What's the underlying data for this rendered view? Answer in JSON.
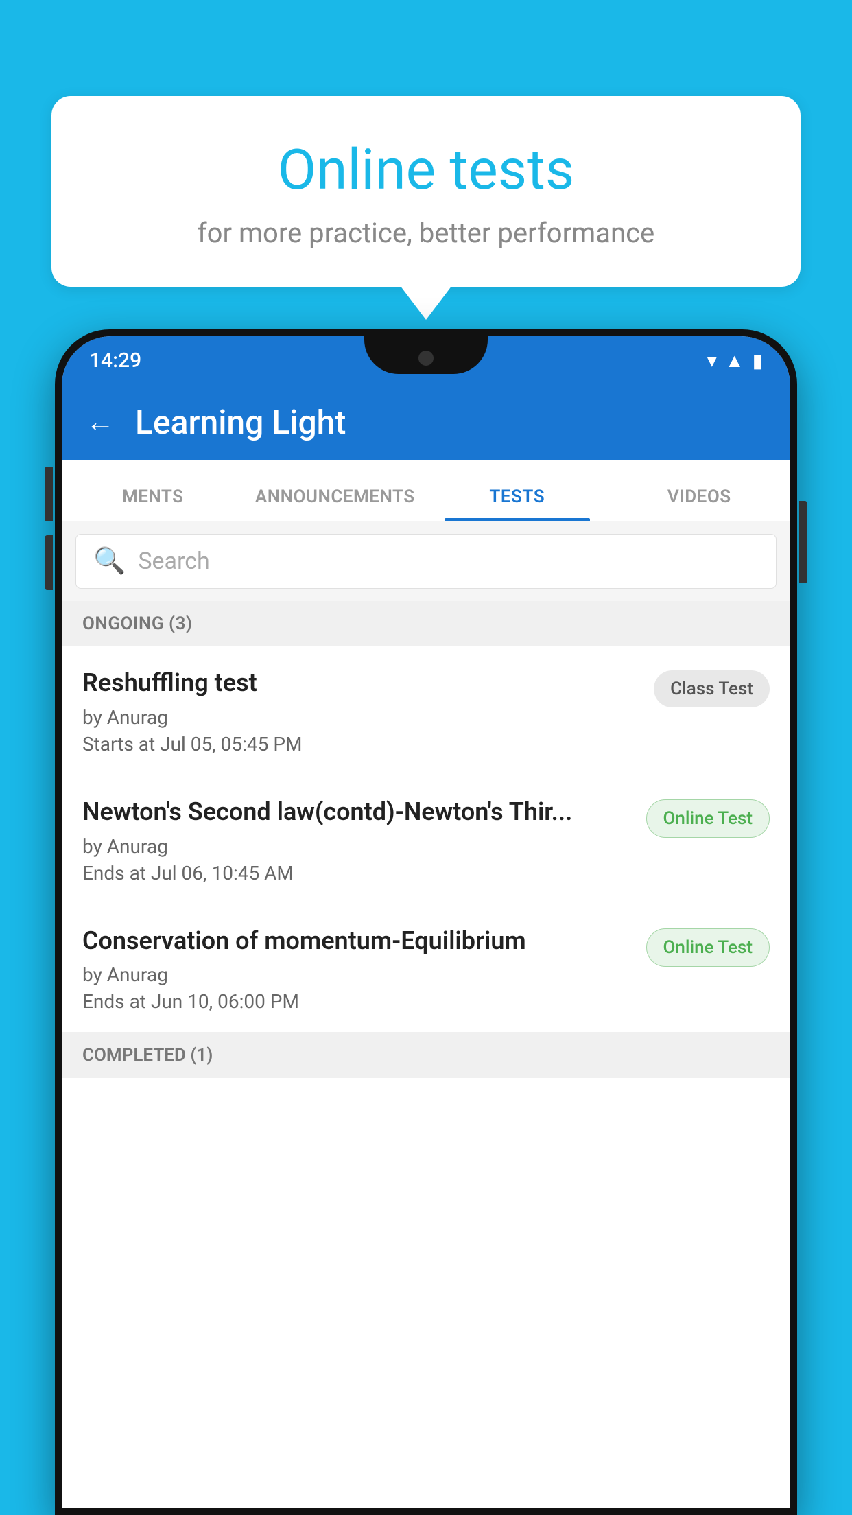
{
  "bubble": {
    "title": "Online tests",
    "subtitle": "for more practice, better performance"
  },
  "statusBar": {
    "time": "14:29",
    "icons": [
      "▼",
      "▲",
      "▮"
    ]
  },
  "appBar": {
    "title": "Learning Light",
    "backLabel": "←"
  },
  "tabs": [
    {
      "label": "MENTS",
      "active": false
    },
    {
      "label": "ANNOUNCEMENTS",
      "active": false
    },
    {
      "label": "TESTS",
      "active": true
    },
    {
      "label": "VIDEOS",
      "active": false
    }
  ],
  "search": {
    "placeholder": "Search"
  },
  "ongoingSection": {
    "label": "ONGOING (3)"
  },
  "tests": [
    {
      "name": "Reshuffling test",
      "by": "by Anurag",
      "time": "Starts at  Jul 05, 05:45 PM",
      "badge": "Class Test",
      "badgeType": "class"
    },
    {
      "name": "Newton's Second law(contd)-Newton's Thir...",
      "by": "by Anurag",
      "time": "Ends at  Jul 06, 10:45 AM",
      "badge": "Online Test",
      "badgeType": "online"
    },
    {
      "name": "Conservation of momentum-Equilibrium",
      "by": "by Anurag",
      "time": "Ends at  Jun 10, 06:00 PM",
      "badge": "Online Test",
      "badgeType": "online"
    }
  ],
  "completedSection": {
    "label": "COMPLETED (1)"
  }
}
